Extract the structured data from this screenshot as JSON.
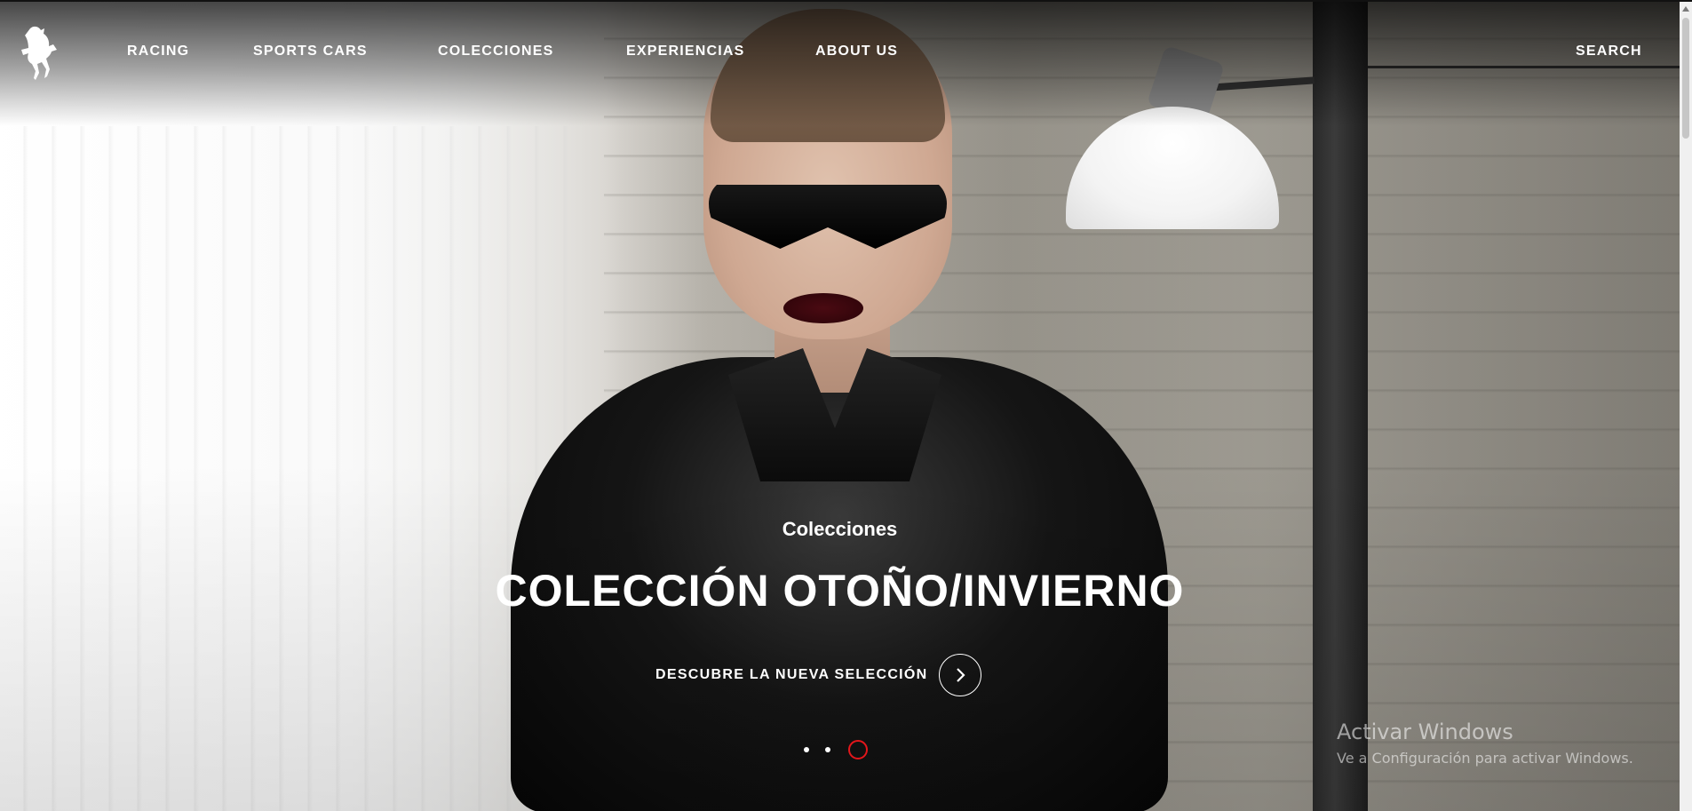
{
  "nav": {
    "items": [
      {
        "label": "RACING"
      },
      {
        "label": "SPORTS CARS"
      },
      {
        "label": "COLECCIONES"
      },
      {
        "label": "EXPERIENCIAS"
      },
      {
        "label": "ABOUT US"
      }
    ],
    "search_label": "SEARCH",
    "logo_icon": "prancing-horse-logo-icon"
  },
  "hero": {
    "eyebrow": "Colecciones",
    "headline": "COLECCIÓN OTOÑO/INVIERNO",
    "cta_label": "DESCUBRE LA NUEVA SELECCIÓN",
    "cta_icon": "chevron-right-icon",
    "slides": {
      "count": 3,
      "active_index": 2
    }
  },
  "watermark": {
    "title": "Activar Windows",
    "subtitle": "Ve a Configuración para activar Windows."
  },
  "colors": {
    "accent_red": "#e3161b",
    "text": "#ffffff"
  }
}
